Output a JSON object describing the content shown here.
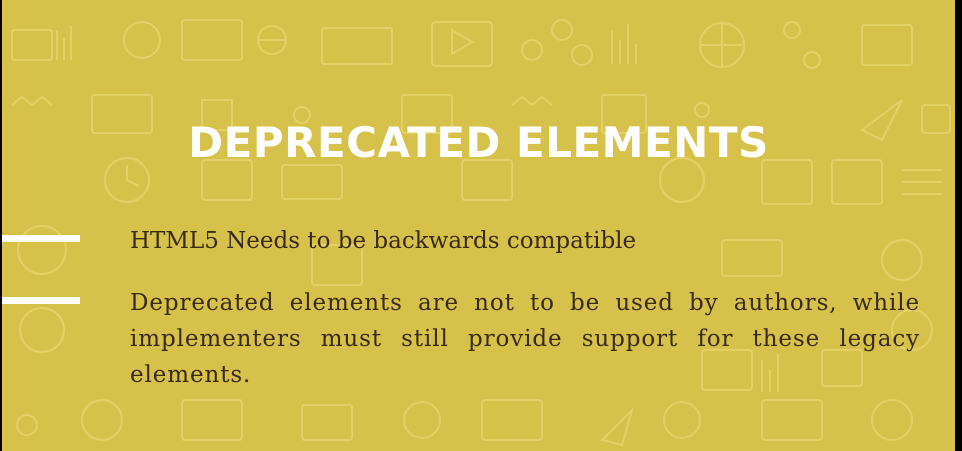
{
  "slide": {
    "title": "DEPRECATED ELEMENTS",
    "bullets": [
      {
        "text": "HTML5 Needs to be backwards compatible"
      },
      {
        "text": "Deprecated elements are not to be used by authors, while implementers must still provide support for these legacy elements."
      }
    ]
  },
  "colors": {
    "background": "#d6c24a",
    "title": "#ffffff",
    "body_text": "#3b2a18",
    "accent_bar": "#ffffff"
  }
}
